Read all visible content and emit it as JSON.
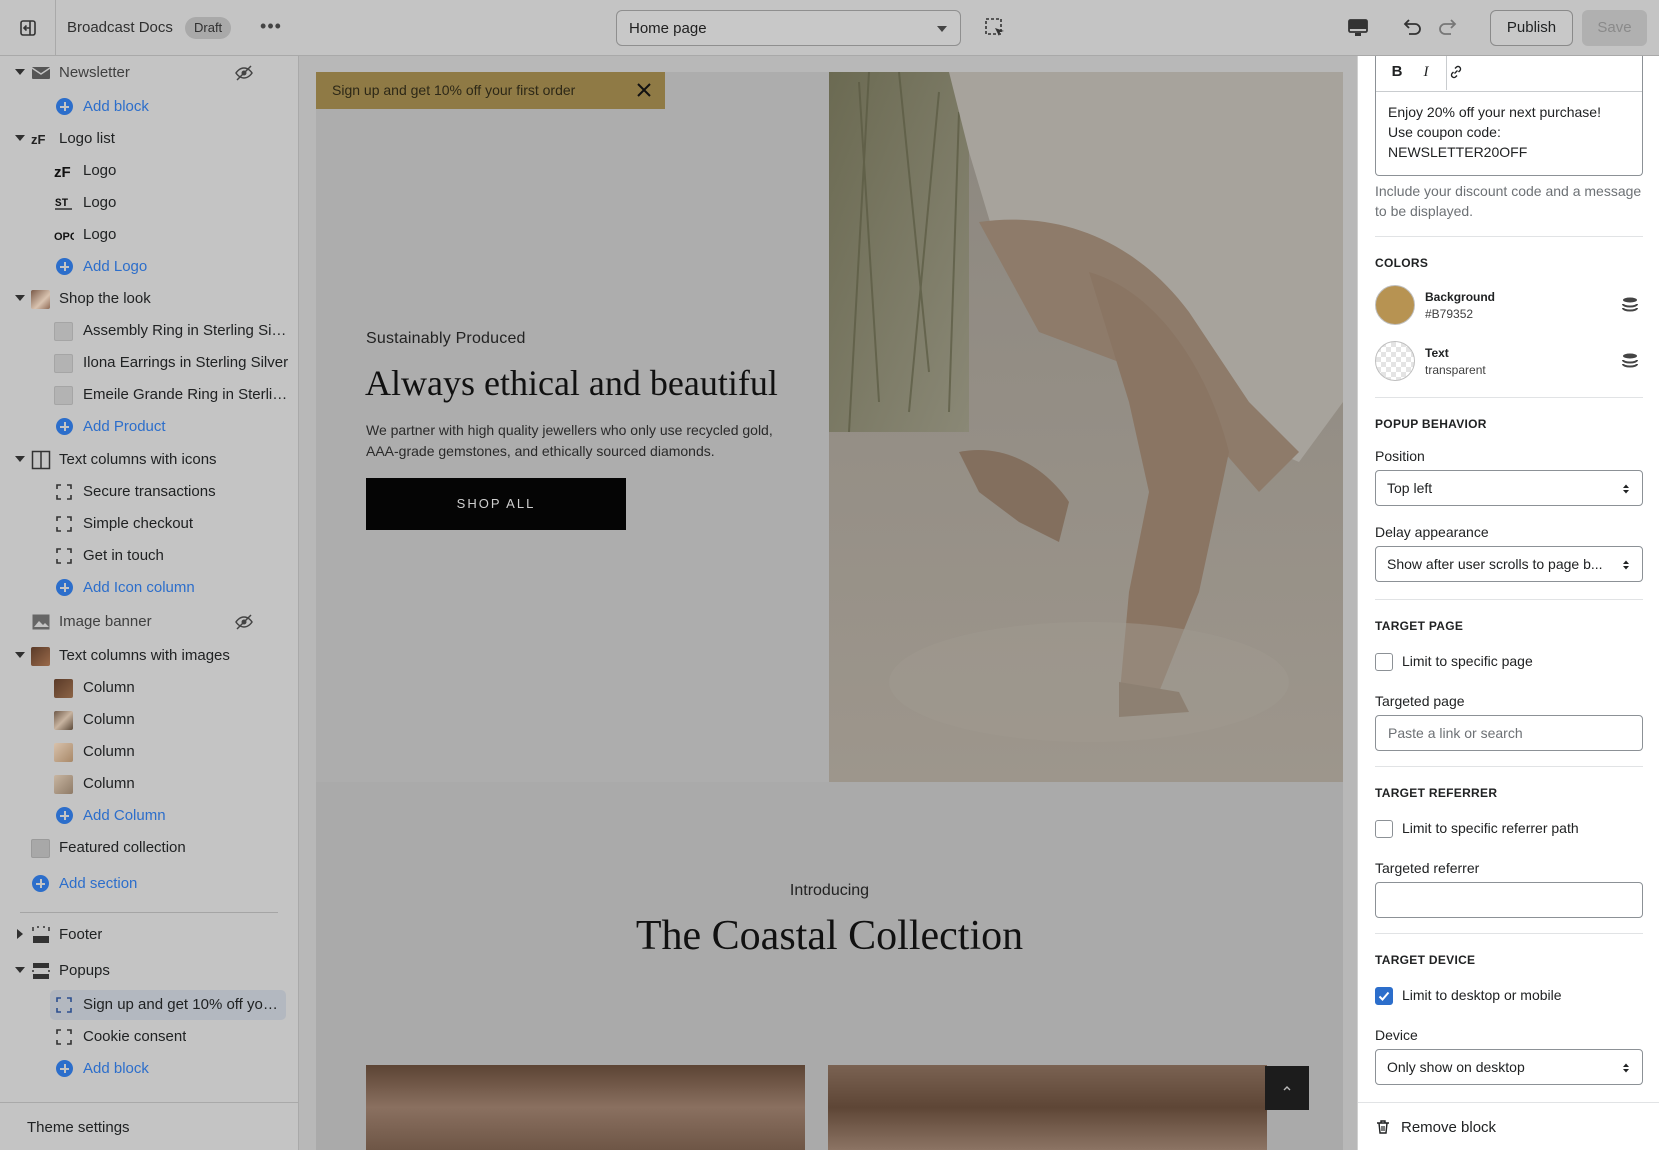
{
  "topbar": {
    "store_name": "Broadcast Docs",
    "status_badge": "Draft",
    "page_select": "Home page",
    "publish_label": "Publish",
    "save_label": "Save"
  },
  "sidebar": {
    "items": [
      {
        "label": "Newsletter"
      },
      {
        "label": "Add block"
      },
      {
        "label": "Logo list"
      },
      {
        "label": "Logo"
      },
      {
        "label": "Logo"
      },
      {
        "label": "Logo"
      },
      {
        "label": "Add Logo"
      },
      {
        "label": "Shop the look"
      },
      {
        "label": "Assembly Ring in Sterling Silver"
      },
      {
        "label": "Ilona Earrings in Sterling Silver"
      },
      {
        "label": "Emeile Grande Ring in Sterlin..."
      },
      {
        "label": "Add Product"
      },
      {
        "label": "Text columns with icons"
      },
      {
        "label": "Secure transactions"
      },
      {
        "label": "Simple checkout"
      },
      {
        "label": "Get in touch"
      },
      {
        "label": "Add Icon column"
      },
      {
        "label": "Image banner"
      },
      {
        "label": "Text columns with images"
      },
      {
        "label": "Column"
      },
      {
        "label": "Column"
      },
      {
        "label": "Column"
      },
      {
        "label": "Column"
      },
      {
        "label": "Add Column"
      },
      {
        "label": "Featured collection"
      },
      {
        "label": "Add section"
      },
      {
        "label": "Footer"
      },
      {
        "label": "Popups"
      },
      {
        "label": "Sign up and get 10% off your ..."
      },
      {
        "label": "Cookie consent"
      },
      {
        "label": "Add block"
      }
    ],
    "theme_settings": "Theme settings"
  },
  "preview": {
    "popup_text": "Sign up and get 10% off your first order",
    "eyebrow": "Sustainably Produced",
    "hero_title": "Always ethical and beautiful",
    "hero_text": "We partner with high quality jewellers who only use recycled gold, AAA-grade gemstones, and ethically sourced diamonds.",
    "shop_button": "SHOP ALL",
    "intro": "Introducing",
    "collection_title": "The Coastal Collection"
  },
  "panel": {
    "message_lines": [
      "Enjoy 20% off your next purchase!",
      "Use coupon code:",
      "NEWSLETTER20OFF"
    ],
    "message_help": "Include your discount code and a message to be displayed.",
    "colors_heading": "COLORS",
    "bg_color_label": "Background",
    "bg_color_value": "#B79352",
    "text_color_label": "Text",
    "text_color_value": "transparent",
    "behavior_heading": "POPUP BEHAVIOR",
    "position_label": "Position",
    "position_value": "Top left",
    "delay_label": "Delay appearance",
    "delay_value": "Show after user scrolls to page b...",
    "target_page_heading": "TARGET PAGE",
    "limit_page_label": "Limit to specific page",
    "targeted_page_label": "Targeted page",
    "targeted_page_placeholder": "Paste a link or search",
    "target_referrer_heading": "TARGET REFERRER",
    "limit_referrer_label": "Limit to specific referrer path",
    "targeted_referrer_label": "Targeted referrer",
    "target_device_heading": "TARGET DEVICE",
    "limit_device_label": "Limit to desktop or mobile",
    "device_label": "Device",
    "device_value": "Only show on desktop",
    "remove_label": "Remove block"
  },
  "colors": {
    "accent": "#2c6ecb",
    "popup_bg": "#B79352"
  }
}
